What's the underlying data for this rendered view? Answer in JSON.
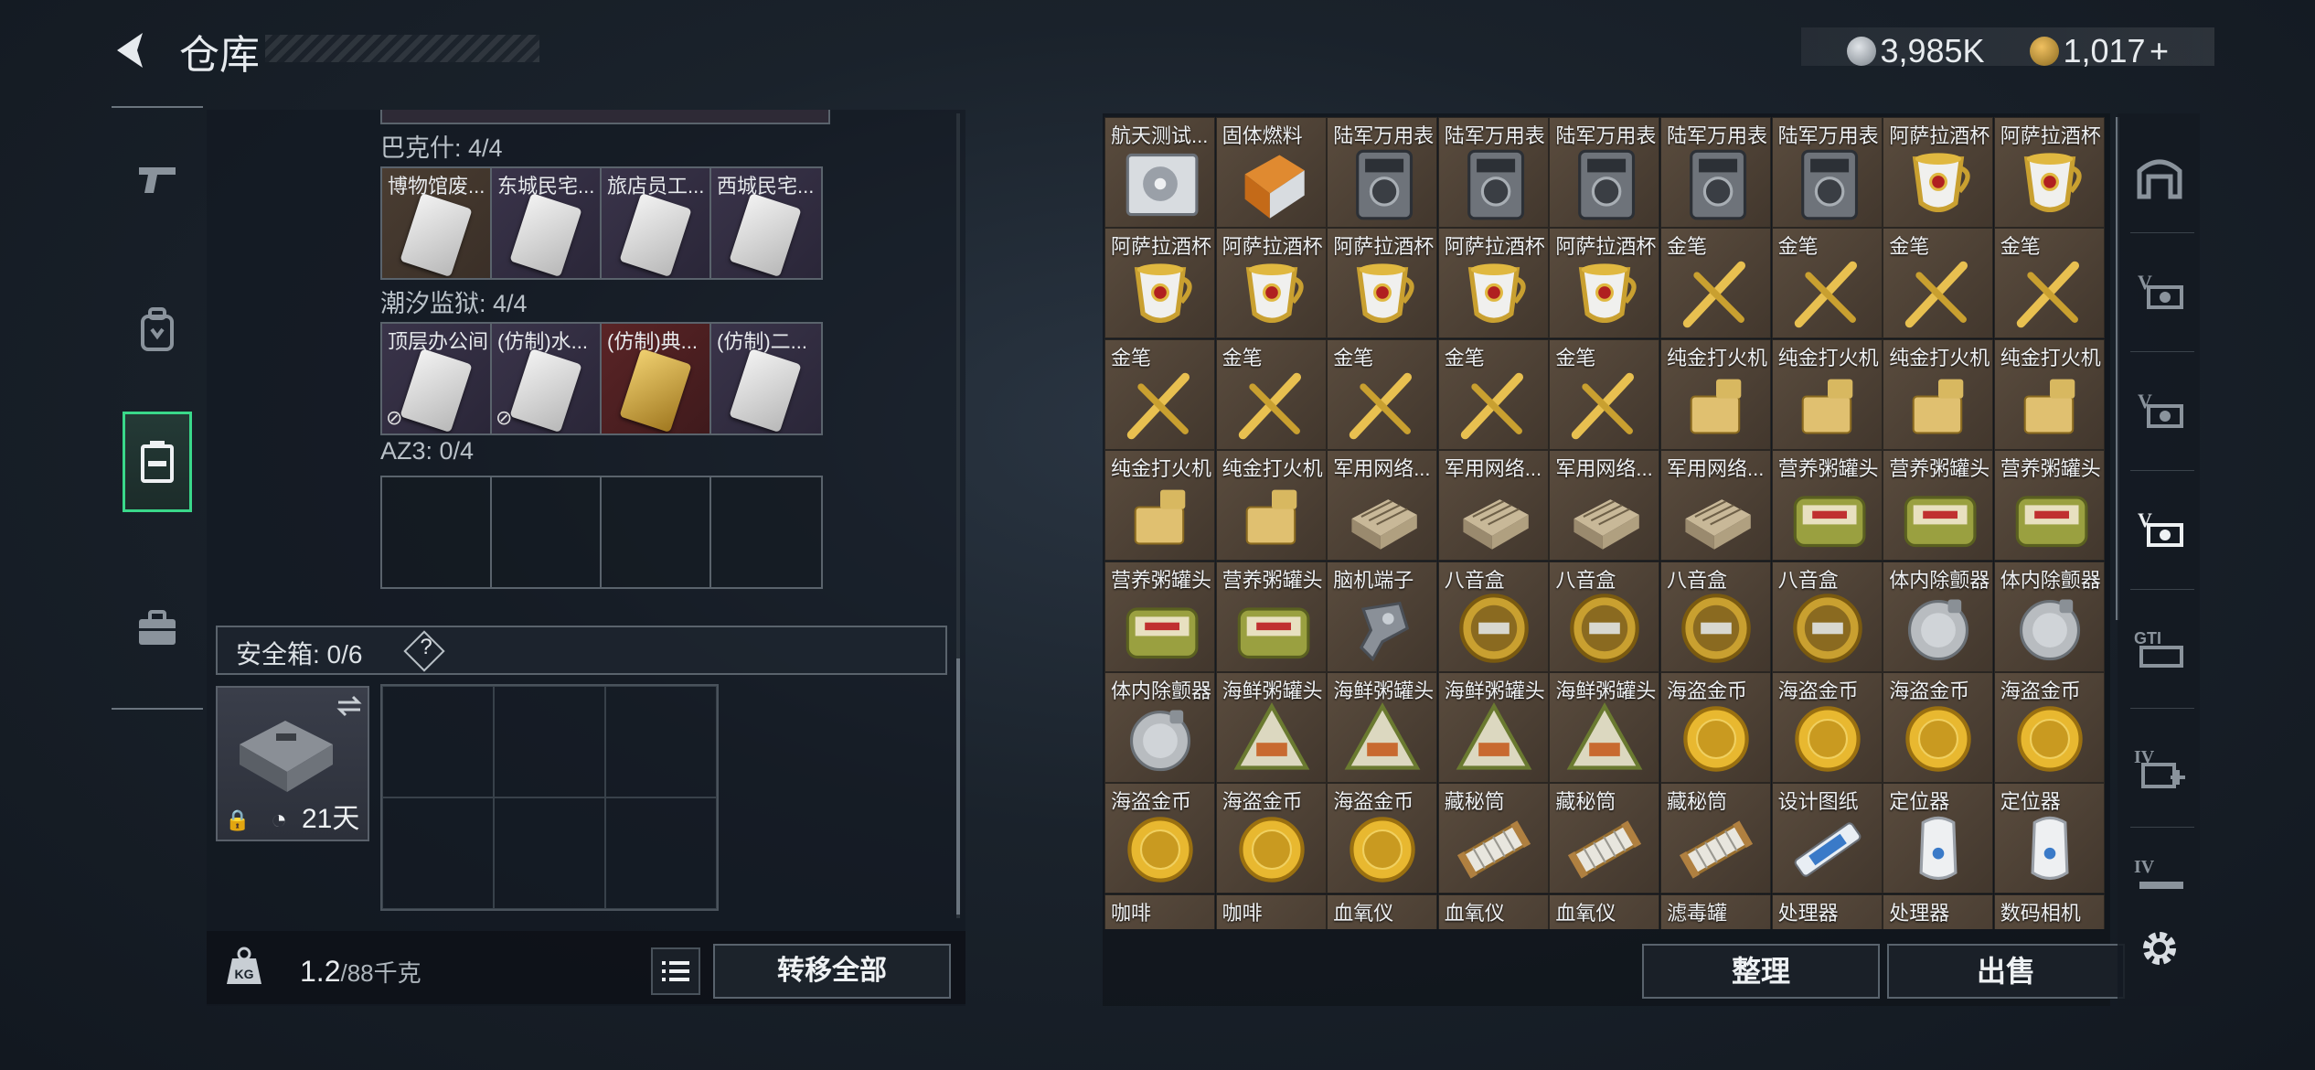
{
  "header": {
    "title": "仓库",
    "currency_1": "3,985K",
    "currency_2": "1,017",
    "currency_2_plus": "+"
  },
  "left_panel": {
    "sections": [
      {
        "label": "巴克什: 4/4",
        "items": [
          {
            "name": "博物馆废...",
            "color": "brown"
          },
          {
            "name": "东城民宅...",
            "color": "purple"
          },
          {
            "name": "旅店员工...",
            "color": "purple"
          },
          {
            "name": "西城民宅...",
            "color": "purple"
          }
        ]
      },
      {
        "label": "潮汐监狱: 4/4",
        "items": [
          {
            "name": "顶层办公间",
            "color": "purple",
            "locked": true
          },
          {
            "name": "(仿制)水...",
            "color": "purple",
            "locked": true
          },
          {
            "name": "(仿制)典...",
            "color": "red",
            "locked": false
          },
          {
            "name": "(仿制)二...",
            "color": "purple",
            "locked": false
          }
        ]
      },
      {
        "label": "AZ3: 0/4",
        "items": []
      }
    ],
    "safebox": {
      "label": "安全箱: 0/6",
      "help": "?",
      "days": "21天"
    },
    "weight": {
      "current": "1.2",
      "capacity": "/88千克",
      "kg_label": "KG"
    },
    "transfer_all": "转移全部"
  },
  "warehouse": {
    "items": [
      {
        "name": "航天测试...",
        "icon": "disk"
      },
      {
        "name": "固体燃料",
        "icon": "fuel"
      },
      {
        "name": "陆军万用表",
        "icon": "multimeter"
      },
      {
        "name": "陆军万用表",
        "icon": "multimeter"
      },
      {
        "name": "陆军万用表",
        "icon": "multimeter"
      },
      {
        "name": "陆军万用表",
        "icon": "multimeter"
      },
      {
        "name": "陆军万用表",
        "icon": "multimeter"
      },
      {
        "name": "阿萨拉酒杯",
        "icon": "cup"
      },
      {
        "name": "阿萨拉酒杯",
        "icon": "cup"
      },
      {
        "name": "阿萨拉酒杯",
        "icon": "cup"
      },
      {
        "name": "阿萨拉酒杯",
        "icon": "cup"
      },
      {
        "name": "阿萨拉酒杯",
        "icon": "cup"
      },
      {
        "name": "阿萨拉酒杯",
        "icon": "cup"
      },
      {
        "name": "阿萨拉酒杯",
        "icon": "cup"
      },
      {
        "name": "金笔",
        "icon": "pen"
      },
      {
        "name": "金笔",
        "icon": "pen"
      },
      {
        "name": "金笔",
        "icon": "pen"
      },
      {
        "name": "金笔",
        "icon": "pen"
      },
      {
        "name": "金笔",
        "icon": "pen"
      },
      {
        "name": "金笔",
        "icon": "pen"
      },
      {
        "name": "金笔",
        "icon": "pen"
      },
      {
        "name": "金笔",
        "icon": "pen"
      },
      {
        "name": "金笔",
        "icon": "pen"
      },
      {
        "name": "纯金打火机",
        "icon": "lighter"
      },
      {
        "name": "纯金打火机",
        "icon": "lighter"
      },
      {
        "name": "纯金打火机",
        "icon": "lighter"
      },
      {
        "name": "纯金打火机",
        "icon": "lighter"
      },
      {
        "name": "纯金打火机",
        "icon": "lighter"
      },
      {
        "name": "纯金打火机",
        "icon": "lighter"
      },
      {
        "name": "军用网络...",
        "icon": "router"
      },
      {
        "name": "军用网络...",
        "icon": "router"
      },
      {
        "name": "军用网络...",
        "icon": "router"
      },
      {
        "name": "军用网络...",
        "icon": "router"
      },
      {
        "name": "营养粥罐头",
        "icon": "can"
      },
      {
        "name": "营养粥罐头",
        "icon": "can"
      },
      {
        "name": "营养粥罐头",
        "icon": "can"
      },
      {
        "name": "营养粥罐头",
        "icon": "can"
      },
      {
        "name": "营养粥罐头",
        "icon": "can"
      },
      {
        "name": "脑机端子",
        "icon": "brainchip"
      },
      {
        "name": "八音盒",
        "icon": "musicbox"
      },
      {
        "name": "八音盒",
        "icon": "musicbox"
      },
      {
        "name": "八音盒",
        "icon": "musicbox"
      },
      {
        "name": "八音盒",
        "icon": "musicbox"
      },
      {
        "name": "体内除颤器",
        "icon": "defib"
      },
      {
        "name": "体内除颤器",
        "icon": "defib"
      },
      {
        "name": "体内除颤器",
        "icon": "defib"
      },
      {
        "name": "海鲜粥罐头",
        "icon": "triangle"
      },
      {
        "name": "海鲜粥罐头",
        "icon": "triangle"
      },
      {
        "name": "海鲜粥罐头",
        "icon": "triangle"
      },
      {
        "name": "海鲜粥罐头",
        "icon": "triangle"
      },
      {
        "name": "海盗金币",
        "icon": "coin"
      },
      {
        "name": "海盗金币",
        "icon": "coin"
      },
      {
        "name": "海盗金币",
        "icon": "coin"
      },
      {
        "name": "海盗金币",
        "icon": "coin"
      },
      {
        "name": "海盗金币",
        "icon": "coin"
      },
      {
        "name": "海盗金币",
        "icon": "coin"
      },
      {
        "name": "海盗金币",
        "icon": "coin"
      },
      {
        "name": "藏秘筒",
        "icon": "cryptex"
      },
      {
        "name": "藏秘筒",
        "icon": "cryptex"
      },
      {
        "name": "藏秘筒",
        "icon": "cryptex"
      },
      {
        "name": "设计图纸",
        "icon": "blueprint"
      },
      {
        "name": "定位器",
        "icon": "tracker"
      },
      {
        "name": "定位器",
        "icon": "tracker"
      },
      {
        "name": "咖啡",
        "icon": "coffee"
      },
      {
        "name": "咖啡",
        "icon": "coffee"
      },
      {
        "name": "血氧仪",
        "icon": "oximeter"
      },
      {
        "name": "血氧仪",
        "icon": "oximeter"
      },
      {
        "name": "血氧仪",
        "icon": "oximeter"
      },
      {
        "name": "滤毒罐",
        "icon": "filter"
      },
      {
        "name": "处理器",
        "icon": "cpu"
      },
      {
        "name": "处理器",
        "icon": "cpu"
      },
      {
        "name": "数码相机",
        "icon": "camera"
      }
    ],
    "sort_label": "整理",
    "sell_label": "出售"
  },
  "colors": {
    "accent": "#3ad88a",
    "cell_bg": "#4d4134",
    "purple_slot": "#3a344a",
    "red_slot": "#5a2426"
  }
}
